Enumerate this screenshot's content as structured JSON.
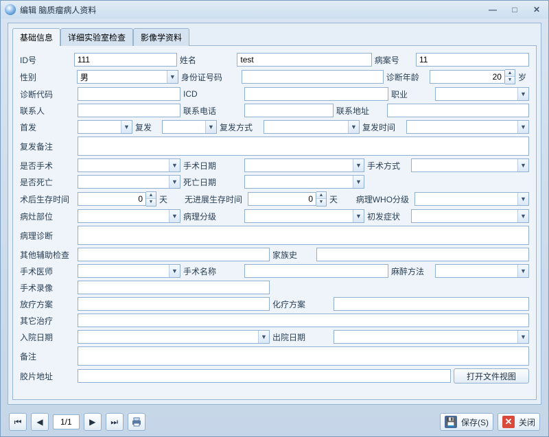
{
  "window": {
    "title": "编辑 脑质瘤病人资料"
  },
  "tabs": [
    "基础信息",
    "详细实验室检查",
    "影像学资料"
  ],
  "labels": {
    "id": "ID号",
    "name": "姓名",
    "caseNo": "病案号",
    "sex": "性别",
    "idCard": "身份证号码",
    "diagAge": "诊断年龄",
    "ageUnit": "岁",
    "diagCode": "诊断代码",
    "icd": "ICD",
    "job": "职业",
    "contact": "联系人",
    "phone": "联系电话",
    "address": "联系地址",
    "first": "首发",
    "relapse": "复发",
    "relapseWay": "复发方式",
    "relapseTime": "复发时间",
    "relapseNote": "复发备注",
    "isSurgery": "是否手术",
    "surgeryDate": "手术日期",
    "surgeryWay": "手术方式",
    "isDead": "是否死亡",
    "deadDate": "死亡日期",
    "postOpSurvival": "术后生存时间",
    "day": "天",
    "noProgSurvival": "无进展生存时间",
    "whoGrade": "病理WHO分级",
    "lesion": "病灶部位",
    "pathGrade": "病理分级",
    "initialSymptom": "初发症状",
    "pathDiag": "病理诊断",
    "otherExam": "其他辅助检查",
    "famHist": "家族史",
    "surgeon": "手术医师",
    "surgeryName": "手术名称",
    "anesthesia": "麻醉方法",
    "surgeryRec": "手术录像",
    "radio": "放疗方案",
    "chemo": "化疗方案",
    "otherTreat": "其它治疗",
    "admitDate": "入院日期",
    "dischargeDate": "出院日期",
    "remark": "备注",
    "filePath": "胶片地址",
    "openFile": "打开文件视图"
  },
  "values": {
    "id": "111",
    "name": "test",
    "caseNo": "11",
    "sex": "男",
    "diagAge": "20",
    "postOpSurvival": "0",
    "noProgSurvival": "0"
  },
  "pager": {
    "text": "1/1"
  },
  "buttons": {
    "save": "保存(S)",
    "close": "关闭"
  }
}
